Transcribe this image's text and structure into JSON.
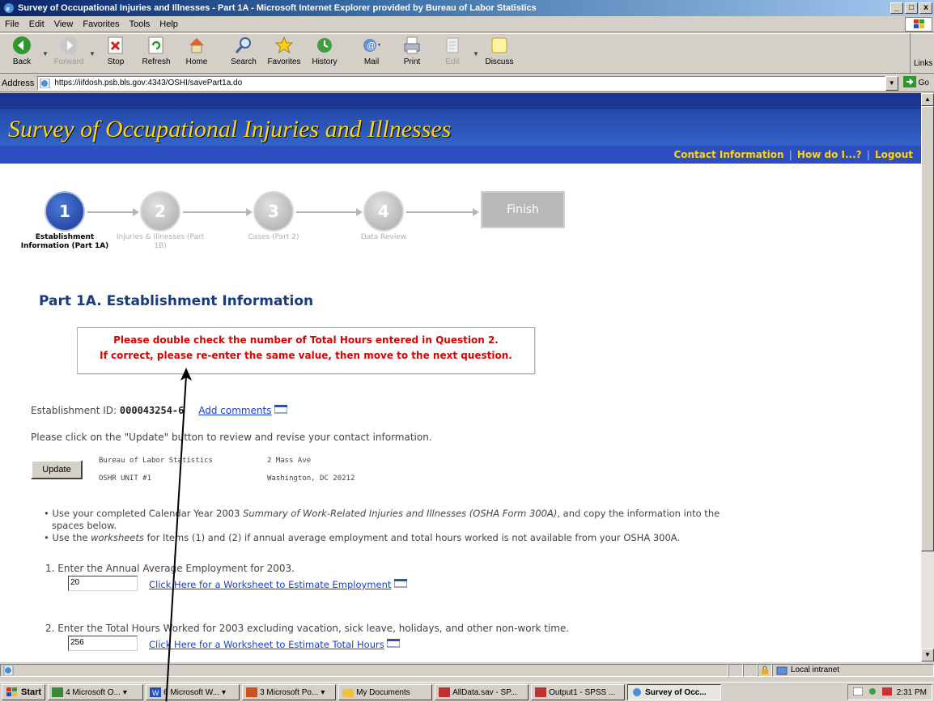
{
  "window": {
    "title": "Survey of Occupational Injuries and Illnesses - Part 1A - Microsoft Internet Explorer provided by Bureau of Labor Statistics",
    "buttons": [
      "_",
      "□",
      "x"
    ]
  },
  "menu": [
    "File",
    "Edit",
    "View",
    "Favorites",
    "Tools",
    "Help"
  ],
  "toolbar": {
    "items": [
      {
        "label": "Back",
        "icon": "back-icon",
        "enabled": true
      },
      {
        "label": "Forward",
        "icon": "forward-icon",
        "enabled": false
      },
      {
        "label": "Stop",
        "icon": "stop-icon",
        "enabled": true
      },
      {
        "label": "Refresh",
        "icon": "refresh-icon",
        "enabled": true
      },
      {
        "label": "Home",
        "icon": "home-icon",
        "enabled": true
      },
      {
        "label": "Search",
        "icon": "search-icon",
        "enabled": true
      },
      {
        "label": "Favorites",
        "icon": "favorites-icon",
        "enabled": true
      },
      {
        "label": "History",
        "icon": "history-icon",
        "enabled": true
      },
      {
        "label": "Mail",
        "icon": "mail-icon",
        "enabled": true
      },
      {
        "label": "Print",
        "icon": "print-icon",
        "enabled": true
      },
      {
        "label": "Edit",
        "icon": "edit-icon",
        "enabled": false
      },
      {
        "label": "Discuss",
        "icon": "discuss-icon",
        "enabled": true
      }
    ],
    "links_label": "Links"
  },
  "address": {
    "label": "Address",
    "url": "https://iifdosh.psb.bls.gov:4343/OSHI/savePart1a.do",
    "go_label": "Go"
  },
  "page": {
    "banner_title": "Survey of Occupational Injuries and Illnesses",
    "nav": [
      "Contact Information",
      "How do I...?",
      "Logout"
    ],
    "steps": [
      {
        "number": "1",
        "label": "Establishment Information (Part 1A)",
        "active": true
      },
      {
        "number": "2",
        "label": "Injuries & Illnesses (Part 1B)",
        "active": false
      },
      {
        "number": "3",
        "label": "Cases (Part 2)",
        "active": false
      },
      {
        "number": "4",
        "label": "Data Review",
        "active": false
      }
    ],
    "finish_label": "Finish",
    "title": "Part 1A. Establishment Information",
    "alert_line1": "Please double check the number of Total Hours entered in Question 2.",
    "alert_line2": "If correct, please re-enter the same value, then move to the next question.",
    "establishment_id_label": "Establishment ID:",
    "establishment_id": "000043254-6",
    "add_comments": "Add comments",
    "update_instruction": "Please click on the \"Update\" button to review and revise your contact information.",
    "update_button": "Update",
    "address_col1_line1": "Bureau of Labor Statistics",
    "address_col1_line2": "OSHR UNIT #1",
    "address_col2_line1": "2 Mass Ave",
    "address_col2_line2": "Washington, DC 20212",
    "bullet1_a": "Use your completed Calendar Year 2003 ",
    "bullet1_em": "Summary of Work-Related Injuries and Illnesses (OSHA Form 300A)",
    "bullet1_b": ", and copy the information into the",
    "bullet1_c": "spaces below.",
    "bullet2_a": "Use the ",
    "bullet2_em": "worksheets",
    "bullet2_b": " for Items (1) and (2) if annual average employment and total hours worked is not available from your OSHA 300A.",
    "q1_label": "1.  Enter the Annual Average Employment for 2003.",
    "q1_value": "20",
    "q1_link": "Click Here for a Worksheet to Estimate Employment",
    "q2_label": "2.  Enter the Total Hours Worked for 2003 excluding vacation, sick leave, holidays, and other non-work time.",
    "q2_value": "256",
    "q2_link": "Click Here for a Worksheet to Estimate Total Hours"
  },
  "status": {
    "zone": "Local intranet"
  },
  "taskbar": {
    "start": "Start",
    "tasks": [
      {
        "label": "4 Microsoft O...",
        "active": false
      },
      {
        "label": "6 Microsoft W...",
        "active": false
      },
      {
        "label": "3 Microsoft Po...",
        "active": false
      },
      {
        "label": "My Documents",
        "active": false
      },
      {
        "label": "AllData.sav - SP...",
        "active": false
      },
      {
        "label": "Output1 - SPSS ...",
        "active": false
      },
      {
        "label": "Survey of Occ...",
        "active": true
      }
    ],
    "clock": "2:31 PM"
  },
  "colors": {
    "banner": "#1e3c9c",
    "banner_text": "#ffd700",
    "alert": "#e00000",
    "link": "#1a3fd0",
    "title": "#1a3a80"
  }
}
